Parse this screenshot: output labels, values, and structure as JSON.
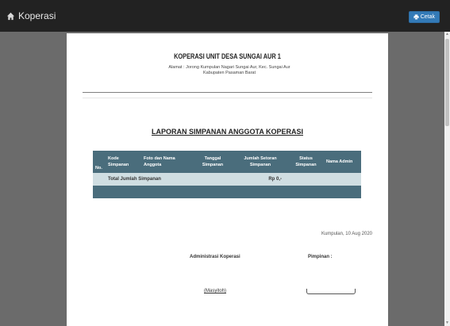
{
  "navbar": {
    "brand_label": "Koperasi",
    "print_label": "Cetak",
    "icons": [
      "home-icon",
      "print-icon"
    ]
  },
  "header": {
    "org_name": "KOPERASI UNIT DESA SUNGAI AUR 1",
    "address_line1": "Alamat : Jorong Kumpulan Nagari Sungai Aur, Kec. Sungai Aur",
    "address_line2": "Kabupaten Pasaman Barat"
  },
  "report": {
    "title": "LAPORAN SIMPANAN ANGGOTA KOPERASI",
    "columns": [
      "No.",
      "Kode Simpanan",
      "Foto dan Nama Anggota",
      "Tanggal Simpanan",
      "Jumlah Setoran Simpanan",
      "Status Simpanan",
      "Nama Admin"
    ],
    "total_label": "Total Jumlah Simpanan",
    "total_value": "Rp 0,-"
  },
  "signature": {
    "place_date": "Kumpulan, 10 Aug 2020",
    "admin_title": "Administrasi Koperasi",
    "chief_title": "Pimpinan :",
    "admin_name": "(Masyitoh)"
  },
  "colors": {
    "navbar_bg": "#222222",
    "page_bg": "#6b6b6b",
    "table_header": "#4a6d7c",
    "total_row": "#d0dee2",
    "print_button": "#337ab7"
  }
}
